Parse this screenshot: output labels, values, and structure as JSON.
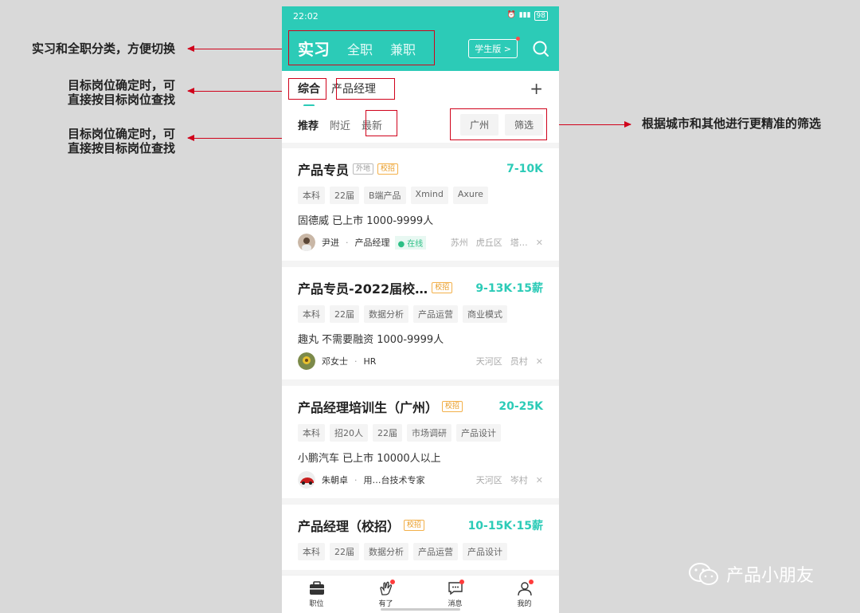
{
  "annotations": {
    "a1": "实习和全职分类，方便切换",
    "a2_line1": "目标岗位确定时，可",
    "a2_line2": "直接按目标岗位查找",
    "a3_line1": "目标岗位确定时，可",
    "a3_line2": "直接按目标岗位查找",
    "a4": "根据城市和其他进行更精准的筛选"
  },
  "watermark": "产品小朋友",
  "status": {
    "time": "22:02",
    "battery": "98"
  },
  "topbar": {
    "tabs": [
      "实习",
      "全职",
      "兼职"
    ],
    "student_label": "学生版 >"
  },
  "subnav": {
    "items": [
      "综合",
      "产品经理"
    ],
    "plus": "+"
  },
  "filter": {
    "sorts": [
      "推荐",
      "附近",
      "最新"
    ],
    "city": "广州",
    "more": "筛选"
  },
  "jobs": [
    {
      "title": "产品专员",
      "badges": [
        "外地",
        "校招"
      ],
      "salary": "7-10K",
      "tags": [
        "本科",
        "22届",
        "B端产品",
        "Xmind",
        "Axure"
      ],
      "company": "固德威 已上市 1000-9999人",
      "recruiter": "尹进",
      "role": "产品经理",
      "online": "在线",
      "loc": [
        "苏州",
        "虎丘区",
        "塔…"
      ]
    },
    {
      "title": "产品专员-2022届校…",
      "badges": [
        "校招"
      ],
      "salary": "9-13K·15薪",
      "tags": [
        "本科",
        "22届",
        "数据分析",
        "产品运营",
        "商业模式"
      ],
      "company": "趣丸 不需要融资 1000-9999人",
      "recruiter": "邓女士",
      "role": "HR",
      "online": "",
      "loc": [
        "天河区",
        "员村"
      ]
    },
    {
      "title": "产品经理培训生（广州）",
      "badges": [
        "校招"
      ],
      "salary": "20-25K",
      "tags": [
        "本科",
        "招20人",
        "22届",
        "市场调研",
        "产品设计"
      ],
      "company": "小鹏汽车 已上市 10000人以上",
      "recruiter": "朱朝卓",
      "role": "用…台技术专家",
      "online": "",
      "loc": [
        "天河区",
        "岑村"
      ]
    },
    {
      "title": "产品经理（校招）",
      "badges": [
        "校招"
      ],
      "salary": "10-15K·15薪",
      "tags": [
        "本科",
        "22届",
        "数据分析",
        "产品运营",
        "产品设计"
      ],
      "company": "",
      "recruiter": "",
      "role": "",
      "online": "",
      "loc": []
    }
  ],
  "bottombar": [
    "职位",
    "有了",
    "消息",
    "我的"
  ],
  "colors": {
    "accent": "#2ccbb7",
    "annotation_red": "#d0021b"
  }
}
